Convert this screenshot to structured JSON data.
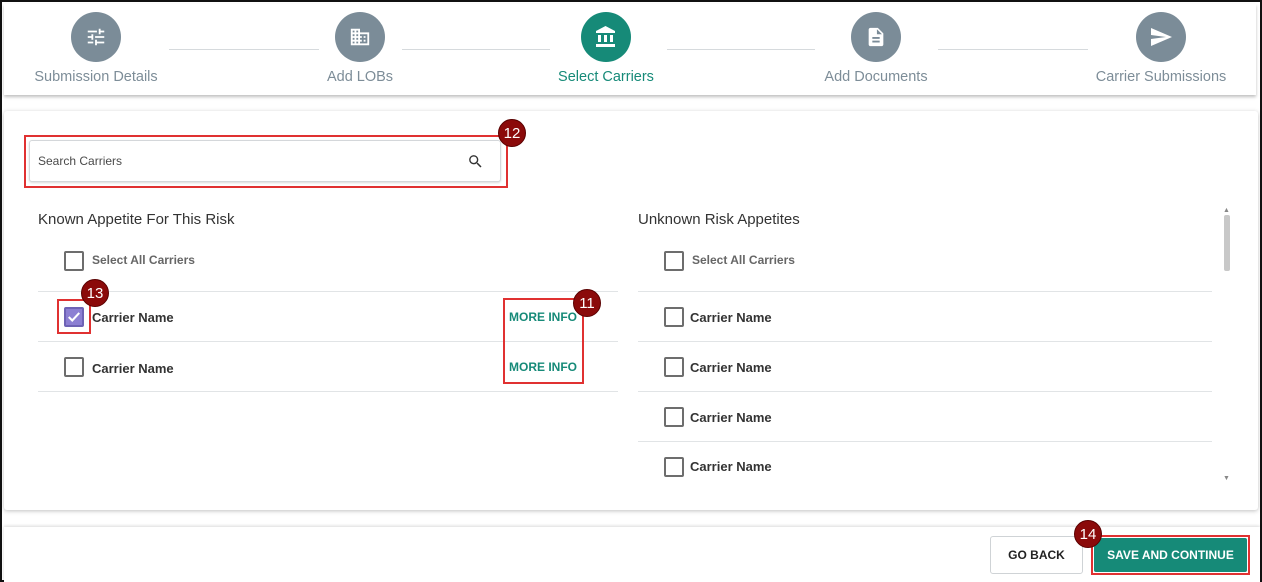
{
  "stepper": {
    "steps": [
      {
        "label": "Submission Details",
        "icon": "sliders-icon",
        "active": false
      },
      {
        "label": "Add LOBs",
        "icon": "building-icon",
        "active": false
      },
      {
        "label": "Select Carriers",
        "icon": "bank-icon",
        "active": true
      },
      {
        "label": "Add Documents",
        "icon": "document-icon",
        "active": false
      },
      {
        "label": "Carrier Submissions",
        "icon": "send-icon",
        "active": false
      }
    ]
  },
  "search": {
    "placeholder": "Search Carriers"
  },
  "known": {
    "title": "Known Appetite For This Risk",
    "select_all": "Select All Carriers",
    "rows": [
      {
        "name": "Carrier Name",
        "checked": true,
        "more_info": "MORE INFO"
      },
      {
        "name": "Carrier Name",
        "checked": false,
        "more_info": "MORE INFO"
      }
    ]
  },
  "unknown": {
    "title": "Unknown Risk Appetites",
    "select_all": "Select All Carriers",
    "rows": [
      {
        "name": "Carrier Name",
        "checked": false
      },
      {
        "name": "Carrier Name",
        "checked": false
      },
      {
        "name": "Carrier Name",
        "checked": false
      },
      {
        "name": "Carrier Name",
        "checked": false
      }
    ]
  },
  "annotations": [
    "11",
    "12",
    "13",
    "14"
  ],
  "footer": {
    "back_label": "GO BACK",
    "save_label": "SAVE AND CONTINUE"
  },
  "colors": {
    "accent": "#168a78",
    "inactive_step": "#7b8c98",
    "highlight": "#e03131",
    "badge": "#8b0a0a",
    "checkbox_checked": "#8c7fd3"
  }
}
